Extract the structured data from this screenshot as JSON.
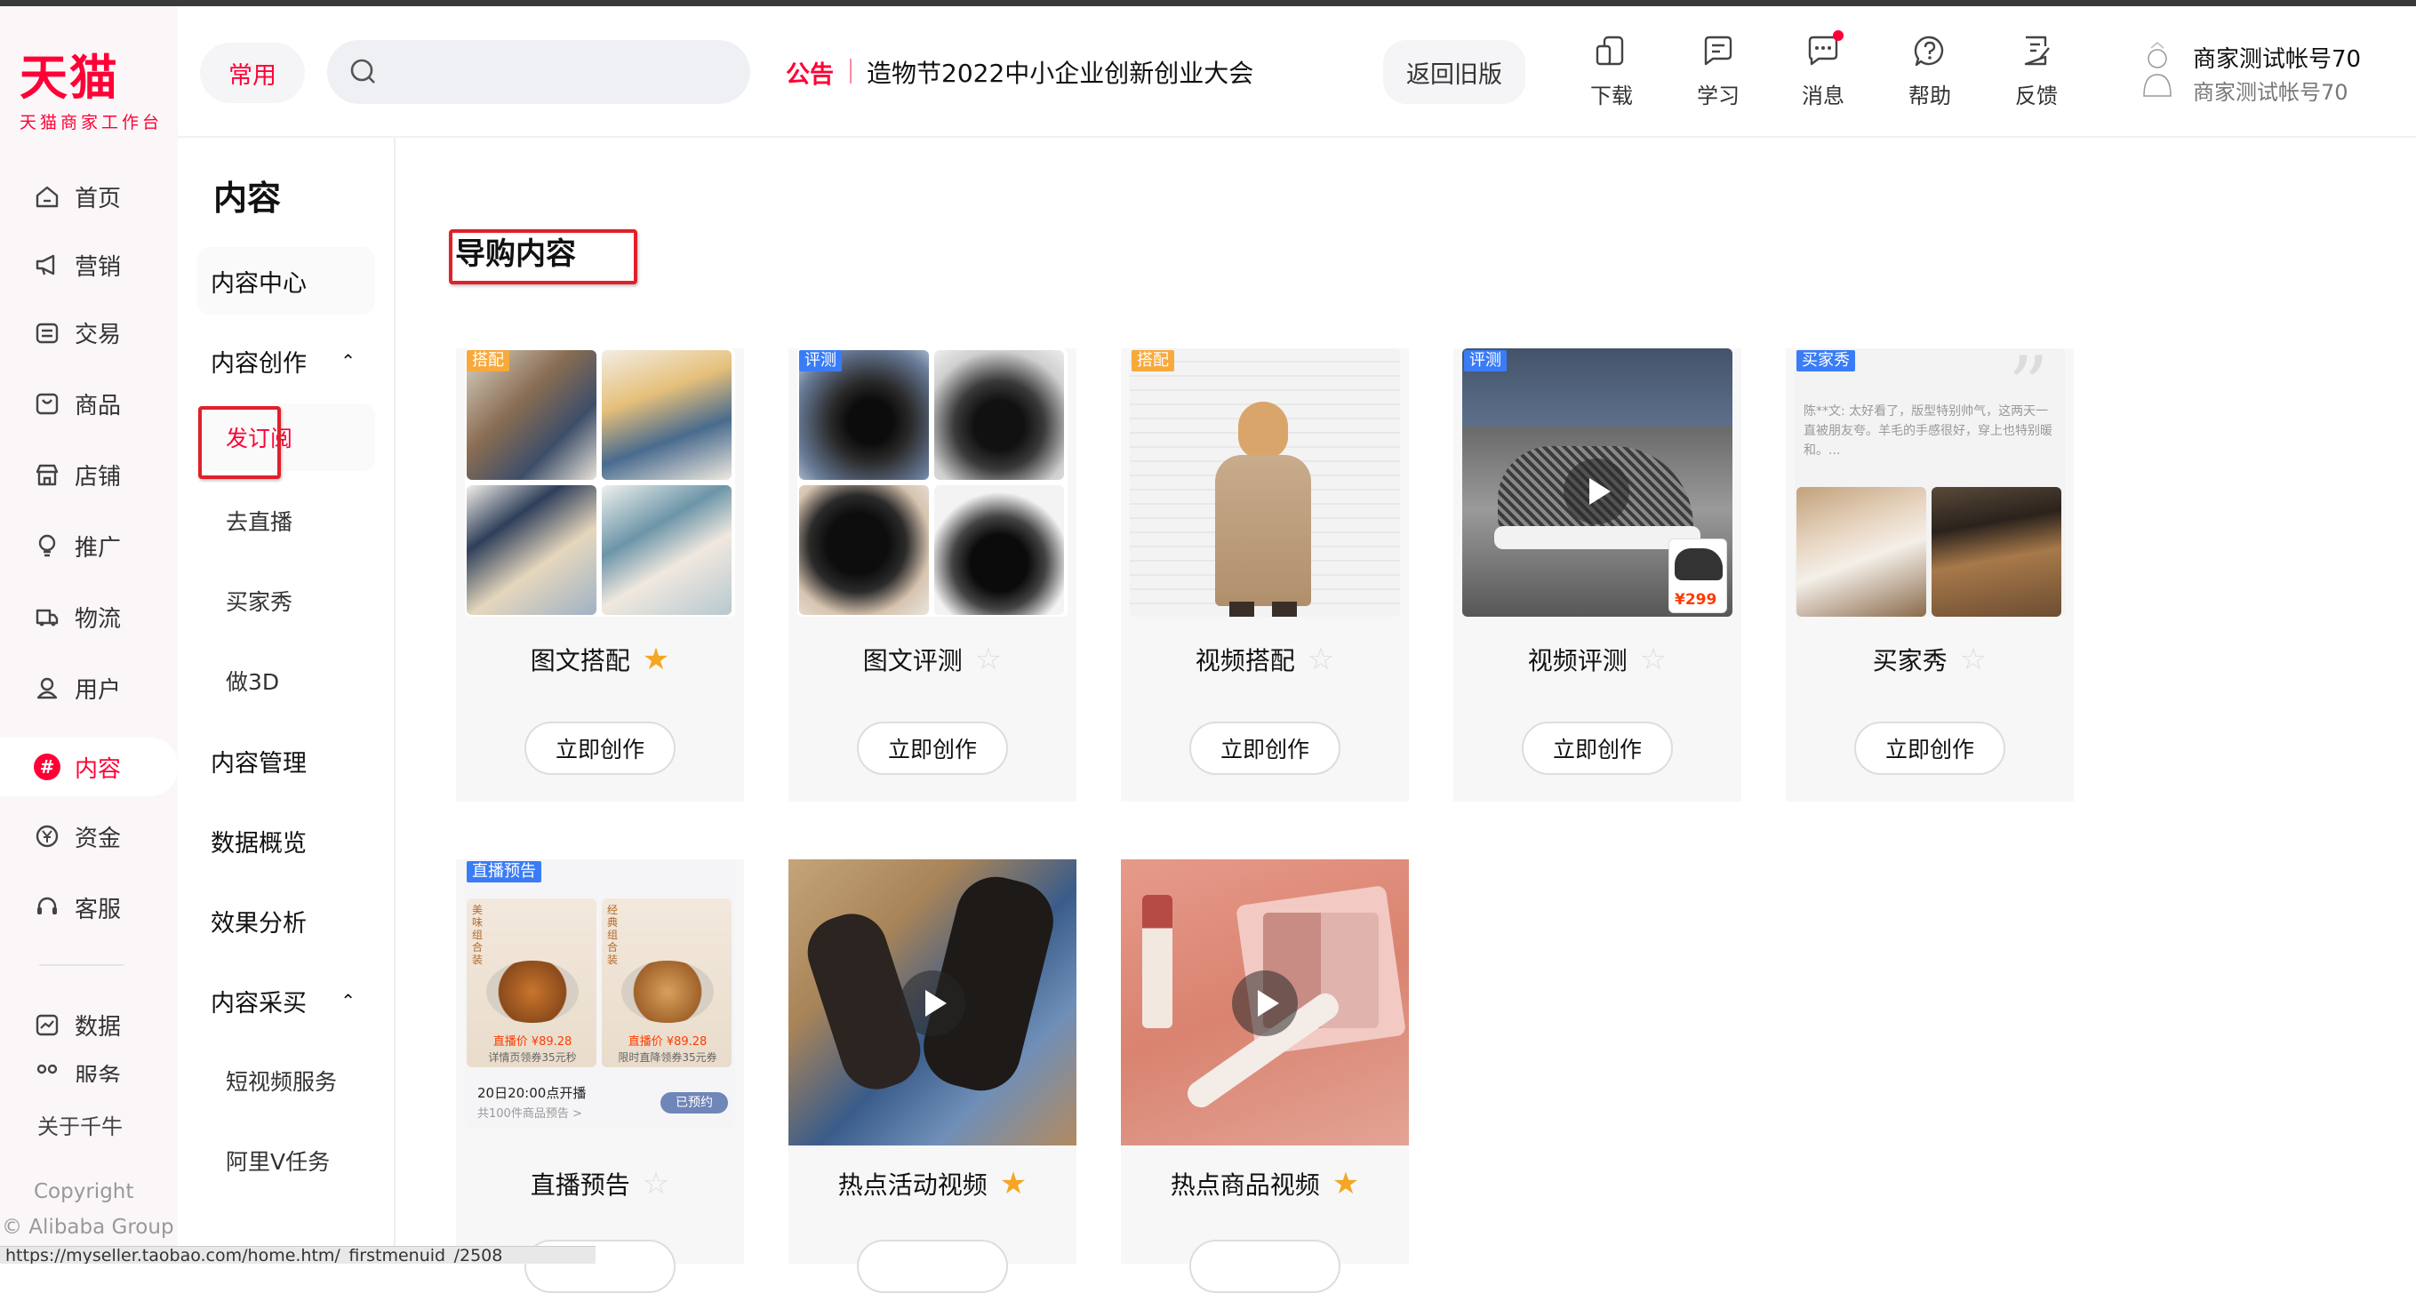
{
  "brand": {
    "name": "天猫",
    "subtitle": "天猫商家工作台"
  },
  "nav": {
    "items": [
      {
        "label": "首页",
        "icon": "home-icon"
      },
      {
        "label": "营销",
        "icon": "megaphone-icon"
      },
      {
        "label": "交易",
        "icon": "trade-icon"
      },
      {
        "label": "商品",
        "icon": "product-icon"
      },
      {
        "label": "店铺",
        "icon": "shop-icon"
      },
      {
        "label": "推广",
        "icon": "promote-icon"
      },
      {
        "label": "物流",
        "icon": "truck-icon"
      },
      {
        "label": "用户",
        "icon": "user-icon"
      },
      {
        "label": "内容",
        "icon": "hash-icon",
        "active": true
      },
      {
        "label": "资金",
        "icon": "yuan-icon"
      },
      {
        "label": "客服",
        "icon": "headset-icon"
      },
      {
        "label": "数据",
        "icon": "chart-icon"
      },
      {
        "label": "服务",
        "icon": "service-icon"
      }
    ],
    "about": "关于千牛",
    "copyright_line1": "Copyright",
    "copyright_line2": "© Alibaba Group"
  },
  "subnav": {
    "title": "内容",
    "items": [
      {
        "label": "内容中心"
      },
      {
        "label": "内容创作",
        "expanded": true
      },
      {
        "label": "发订阅",
        "level": 2,
        "selected": true
      },
      {
        "label": "去直播",
        "level": 2
      },
      {
        "label": "买家秀",
        "level": 2
      },
      {
        "label": "做3D",
        "level": 2
      },
      {
        "label": "内容管理"
      },
      {
        "label": "数据概览"
      },
      {
        "label": "效果分析"
      },
      {
        "label": "内容采买",
        "expanded": true
      },
      {
        "label": "短视频服务",
        "level": 2
      },
      {
        "label": "阿里V任务",
        "level": 2
      }
    ]
  },
  "header": {
    "common_label": "常用",
    "search_placeholder": "",
    "notice_label": "公告",
    "notice_text": "造物节2022中小企业创新创业大会",
    "old_version_label": "返回旧版",
    "tools": [
      {
        "label": "下载",
        "icon": "download-icon"
      },
      {
        "label": "学习",
        "icon": "learn-icon"
      },
      {
        "label": "消息",
        "icon": "message-icon",
        "badge": true
      },
      {
        "label": "帮助",
        "icon": "help-icon"
      },
      {
        "label": "反馈",
        "icon": "feedback-icon"
      }
    ],
    "account_name": "商家测试帐号70",
    "account_sub": "商家测试帐号70"
  },
  "main": {
    "section_title": "导购内容",
    "cta_label": "立即创作",
    "cards": [
      {
        "name": "图文搭配",
        "tag": "搭配",
        "tag_color": "#f7a93b",
        "starred": true
      },
      {
        "name": "图文评测",
        "tag": "评测",
        "tag_color": "#3a7cf6",
        "starred": false
      },
      {
        "name": "视频搭配",
        "tag": "搭配",
        "tag_color": "#f7a93b",
        "starred": false
      },
      {
        "name": "视频评测",
        "tag": "评测",
        "tag_color": "#3a7cf6",
        "starred": false,
        "price": "¥299"
      },
      {
        "name": "买家秀",
        "tag": "买家秀",
        "tag_color": "#3a7cf6",
        "starred": false,
        "review": "陈**文: 太好看了，版型特别帅气，这两天一直被朋友夸。羊毛的手感很好，穿上也特别暖和。..."
      },
      {
        "name": "直播预告",
        "tag": "直播预告",
        "tag_color": "#3a7cf6",
        "starred": false,
        "preview": {
          "left_title": "美味组合装",
          "right_title": "经典组合装",
          "left_price": "直播价 ¥89.28",
          "right_price": "直播价 ¥89.28",
          "left_note": "详情页领券35元秒",
          "right_note": "限时直降领券35元券",
          "time": "20日20:00点开播",
          "count": "共100件商品预告 >",
          "status": "已预约"
        }
      },
      {
        "name": "热点活动视频",
        "starred": true
      },
      {
        "name": "热点商品视频",
        "starred": true
      }
    ]
  },
  "status_url": "https://myseller.taobao.com/home.htm/_firstmenuid_/2508",
  "colors": {
    "brand": "#ff0036",
    "star_on": "#f5a623",
    "star_off": "#dddddd",
    "highlight_box": "#e0202a"
  }
}
